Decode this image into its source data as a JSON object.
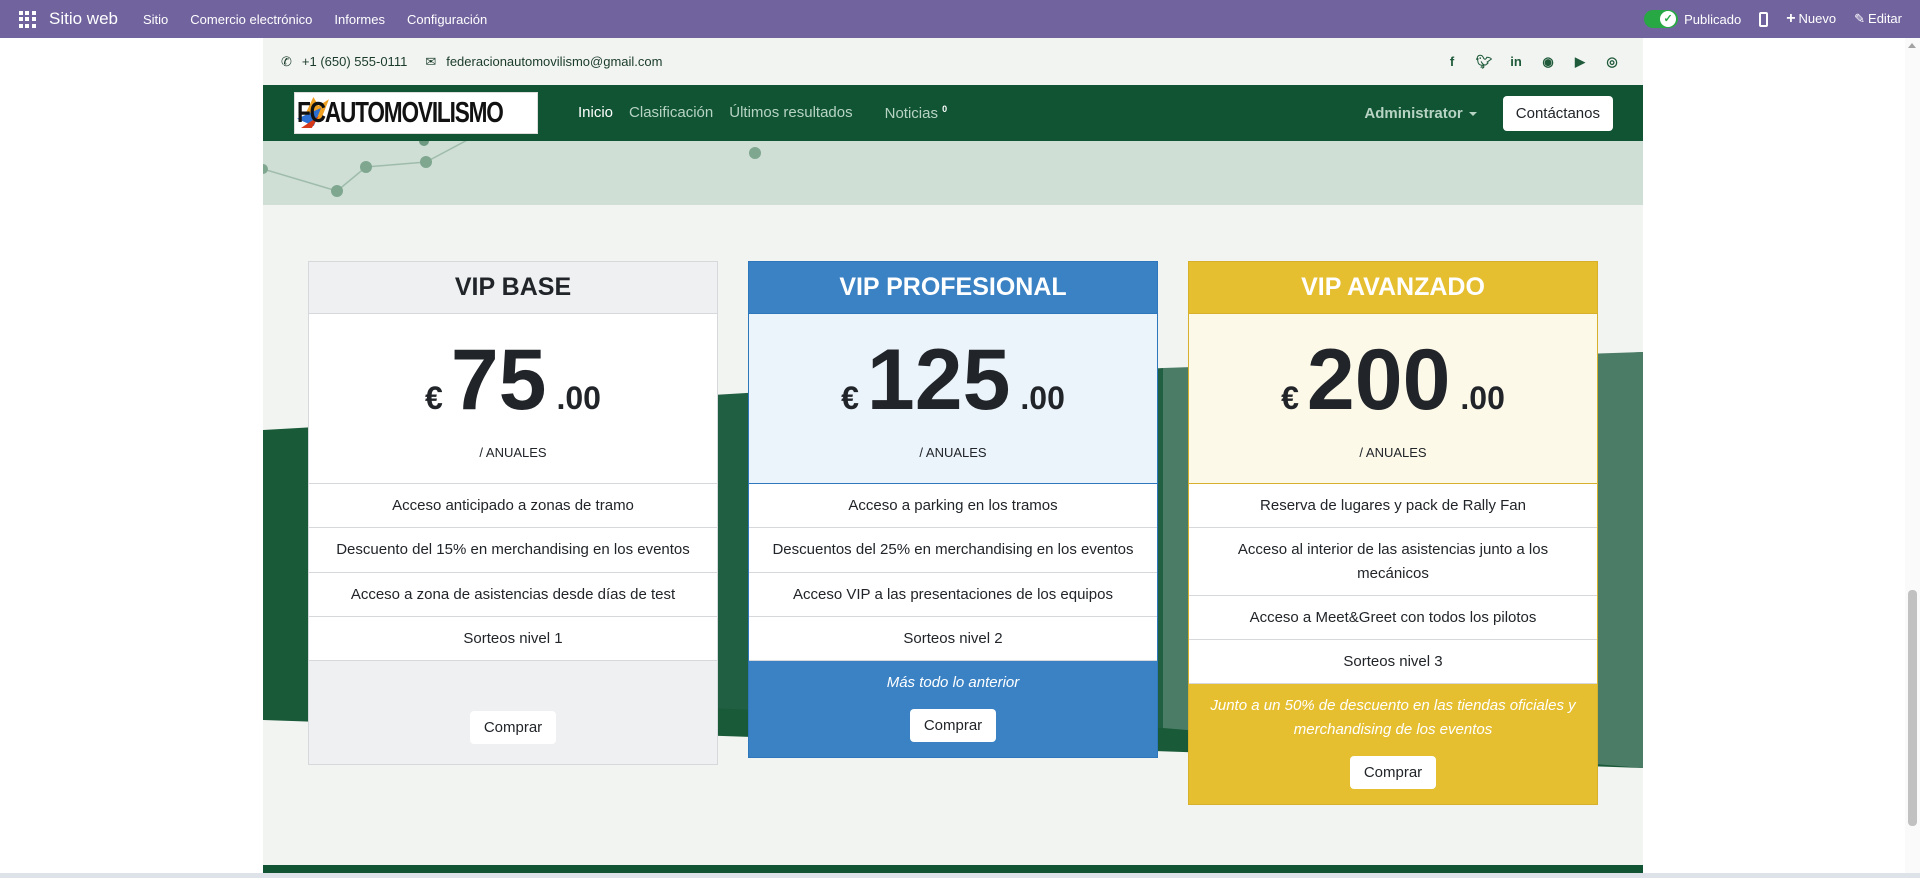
{
  "adminbar": {
    "brand": "Sitio web",
    "menu": [
      "Sitio",
      "Comercio electrónico",
      "Informes",
      "Configuración"
    ],
    "published_label": "Publicado",
    "new_label": "Nuevo",
    "edit_label": "Editar"
  },
  "topinfo": {
    "phone": "+1 (650) 555-0111",
    "email": "federacionautomovilismo@gmail.com",
    "socials": [
      "facebook-icon",
      "twitter-icon",
      "linkedin-icon",
      "github-icon",
      "youtube-icon",
      "instagram-icon"
    ]
  },
  "navbar": {
    "logo_text": "FCAUTOMOVILISMO",
    "links": [
      "Inicio",
      "Clasificación",
      "Últimos resultados",
      "Noticias"
    ],
    "news_badge": "0",
    "admin_label": "Administrator",
    "contact_label": "Contáctanos"
  },
  "cards": [
    {
      "title": "VIP BASE",
      "currency": "€",
      "amount": "75",
      "decimals": ".00",
      "period": "/ ANUALES",
      "features": [
        "Acceso anticipado a zonas de tramo",
        "Descuento del 15% en merchandising en los eventos",
        "Acceso a zona de asistencias desde días de test",
        "Sorteos nivel 1"
      ],
      "note": "",
      "button": "Comprar"
    },
    {
      "title": "VIP PROFESIONAL",
      "currency": "€",
      "amount": "125",
      "decimals": ".00",
      "period": "/ ANUALES",
      "features": [
        "Acceso a parking en los tramos",
        "Descuentos del 25% en merchandising en los eventos",
        "Acceso VIP a las presentaciones de los equipos",
        "Sorteos nivel 2"
      ],
      "note": "Más todo lo anterior",
      "button": "Comprar"
    },
    {
      "title": "VIP AVANZADO",
      "currency": "€",
      "amount": "200",
      "decimals": ".00",
      "period": "/ ANUALES",
      "features": [
        "Reserva de lugares y pack de Rally Fan",
        "Acceso al interior de las asistencias junto a los mecánicos",
        "Acceso a Meet&Greet con todos los pilotos",
        "Sorteos nivel 3"
      ],
      "note": "Junto a un 50% de descuento en las tiendas oficiales y merchandising de los eventos",
      "button": "Comprar"
    }
  ],
  "colors": {
    "adminbar": "#71639e",
    "navbar": "#105433",
    "pro_accent": "#3b82c4",
    "adv_accent": "#e6bf31"
  }
}
